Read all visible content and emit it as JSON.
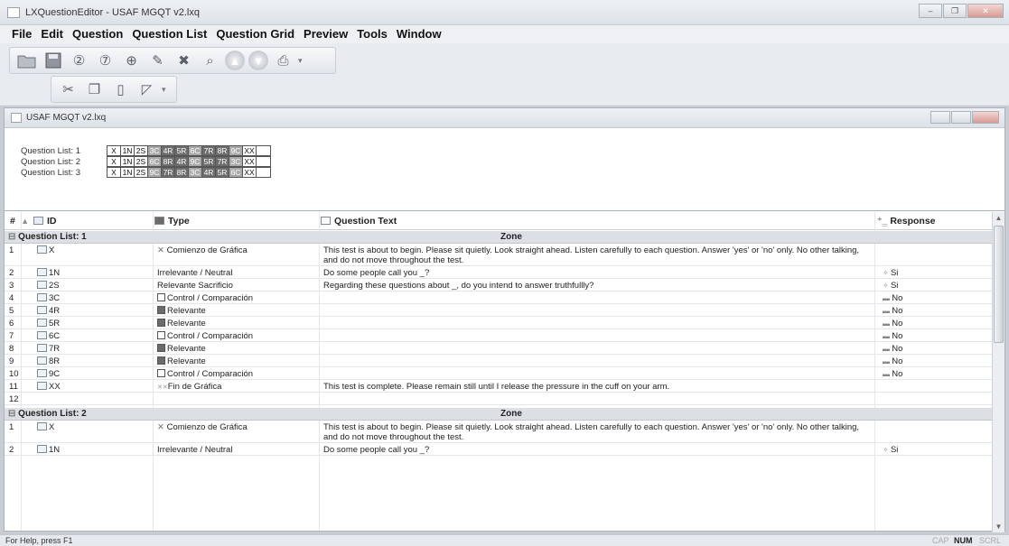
{
  "window": {
    "title": "LXQuestionEditor - USAF MGQT v2.lxq",
    "buttons": [
      "–",
      "❐",
      "✕"
    ]
  },
  "menu": [
    "File",
    "Edit",
    "Question",
    "Question List",
    "Question Grid",
    "Preview",
    "Tools",
    "Window"
  ],
  "toolbar": {
    "row1": [
      "open-folder-icon",
      "save-icon",
      "question-add-icon",
      "question-remove-icon",
      "insert-icon",
      "edit-icon",
      "delete-icon",
      "zoom-icon",
      "move-up-icon",
      "move-down-icon",
      "export-icon"
    ],
    "row2": [
      "cut-icon",
      "copy-icon",
      "paste-icon",
      "eraser-icon"
    ]
  },
  "document": {
    "title": "USAF MGQT v2.lxq"
  },
  "question_lists": [
    {
      "label": "Question List: 1",
      "cells": [
        {
          "t": "X",
          "s": "w"
        },
        {
          "t": "1N",
          "s": "w"
        },
        {
          "t": "2S",
          "s": "w"
        },
        {
          "t": "3C",
          "s": "m"
        },
        {
          "t": "4R",
          "s": "d"
        },
        {
          "t": "5R",
          "s": "d"
        },
        {
          "t": "6C",
          "s": "m"
        },
        {
          "t": "7R",
          "s": "d"
        },
        {
          "t": "8R",
          "s": "d"
        },
        {
          "t": "9C",
          "s": "m"
        },
        {
          "t": "XX",
          "s": "w"
        },
        {
          "t": "",
          "s": "w"
        }
      ]
    },
    {
      "label": "Question List: 2",
      "cells": [
        {
          "t": "X",
          "s": "w"
        },
        {
          "t": "1N",
          "s": "w"
        },
        {
          "t": "2S",
          "s": "w"
        },
        {
          "t": "6C",
          "s": "m"
        },
        {
          "t": "8R",
          "s": "d"
        },
        {
          "t": "4R",
          "s": "d"
        },
        {
          "t": "9C",
          "s": "m"
        },
        {
          "t": "5R",
          "s": "d"
        },
        {
          "t": "7R",
          "s": "d"
        },
        {
          "t": "3C",
          "s": "m"
        },
        {
          "t": "XX",
          "s": "w"
        },
        {
          "t": "",
          "s": "w"
        }
      ]
    },
    {
      "label": "Question List: 3",
      "cells": [
        {
          "t": "X",
          "s": "w"
        },
        {
          "t": "1N",
          "s": "w"
        },
        {
          "t": "2S",
          "s": "w"
        },
        {
          "t": "9C",
          "s": "m"
        },
        {
          "t": "7R",
          "s": "d"
        },
        {
          "t": "8R",
          "s": "d"
        },
        {
          "t": "3C",
          "s": "m"
        },
        {
          "t": "4R",
          "s": "d"
        },
        {
          "t": "5R",
          "s": "d"
        },
        {
          "t": "6C",
          "s": "m"
        },
        {
          "t": "XX",
          "s": "w"
        },
        {
          "t": "",
          "s": "w"
        }
      ]
    }
  ],
  "grid": {
    "headers": {
      "num": "#",
      "id": "ID",
      "type": "Type",
      "text": "Question Text",
      "response": "Response"
    },
    "groups": [
      {
        "label": "Question List: 1",
        "zone": "Zone",
        "rows": [
          {
            "n": "1",
            "id": "X",
            "type": "Comienzo de Gráfica",
            "mark": "x",
            "text": "This test is about to begin. Please sit quietly. Look straight ahead. Listen carefully to each question. Answer 'yes' or 'no' only. No other talking, and do not move throughout the test.",
            "resp": "",
            "tall": true
          },
          {
            "n": "2",
            "id": "1N",
            "type": "Irrelevante / Neutral",
            "mark": "",
            "text": "Do some people call you _?",
            "resp": "Si",
            "rmark": "+"
          },
          {
            "n": "3",
            "id": "2S",
            "type": "Relevante Sacrificio",
            "mark": "",
            "text": "Regarding these questions about _, do you intend to answer truthfullly?",
            "resp": "Si",
            "rmark": "+"
          },
          {
            "n": "4",
            "id": "3C",
            "type": "Control / Comparación",
            "mark": "c",
            "text": "",
            "resp": "No",
            "rmark": "="
          },
          {
            "n": "5",
            "id": "4R",
            "type": "Relevante",
            "mark": "r",
            "text": "",
            "resp": "No",
            "rmark": "="
          },
          {
            "n": "6",
            "id": "5R",
            "type": "Relevante",
            "mark": "r",
            "text": "",
            "resp": "No",
            "rmark": "="
          },
          {
            "n": "7",
            "id": "6C",
            "type": "Control / Comparación",
            "mark": "c",
            "text": "",
            "resp": "No",
            "rmark": "="
          },
          {
            "n": "8",
            "id": "7R",
            "type": "Relevante",
            "mark": "r",
            "text": "",
            "resp": "No",
            "rmark": "="
          },
          {
            "n": "9",
            "id": "8R",
            "type": "Relevante",
            "mark": "r",
            "text": "",
            "resp": "No",
            "rmark": "="
          },
          {
            "n": "10",
            "id": "9C",
            "type": "Control / Comparación",
            "mark": "c",
            "text": "",
            "resp": "No",
            "rmark": "="
          },
          {
            "n": "11",
            "id": "XX",
            "type": "Fin de Gráfica",
            "mark": "xx",
            "text": "This test is complete. Please remain still until I release the pressure in the cuff on your arm.",
            "resp": ""
          },
          {
            "n": "12",
            "id": "",
            "type": "",
            "mark": "",
            "text": "",
            "resp": "",
            "noicon": true
          }
        ]
      },
      {
        "label": "Question List: 2",
        "zone": "Zone",
        "rows": [
          {
            "n": "1",
            "id": "X",
            "type": "Comienzo de Gráfica",
            "mark": "x",
            "text": "This test is about to begin. Please sit quietly. Look straight ahead. Listen carefully to each question. Answer 'yes' or 'no' only. No other talking, and do not move throughout the test.",
            "resp": "",
            "tall": true
          },
          {
            "n": "2",
            "id": "1N",
            "type": "Irrelevante / Neutral",
            "mark": "",
            "text": "Do some people call you _?",
            "resp": "Si",
            "rmark": "+"
          }
        ]
      }
    ]
  },
  "status": {
    "help": "For Help, press F1",
    "indicators": [
      {
        "t": "CAP",
        "on": false
      },
      {
        "t": "NUM",
        "on": true
      },
      {
        "t": "SCRL",
        "on": false
      }
    ]
  }
}
